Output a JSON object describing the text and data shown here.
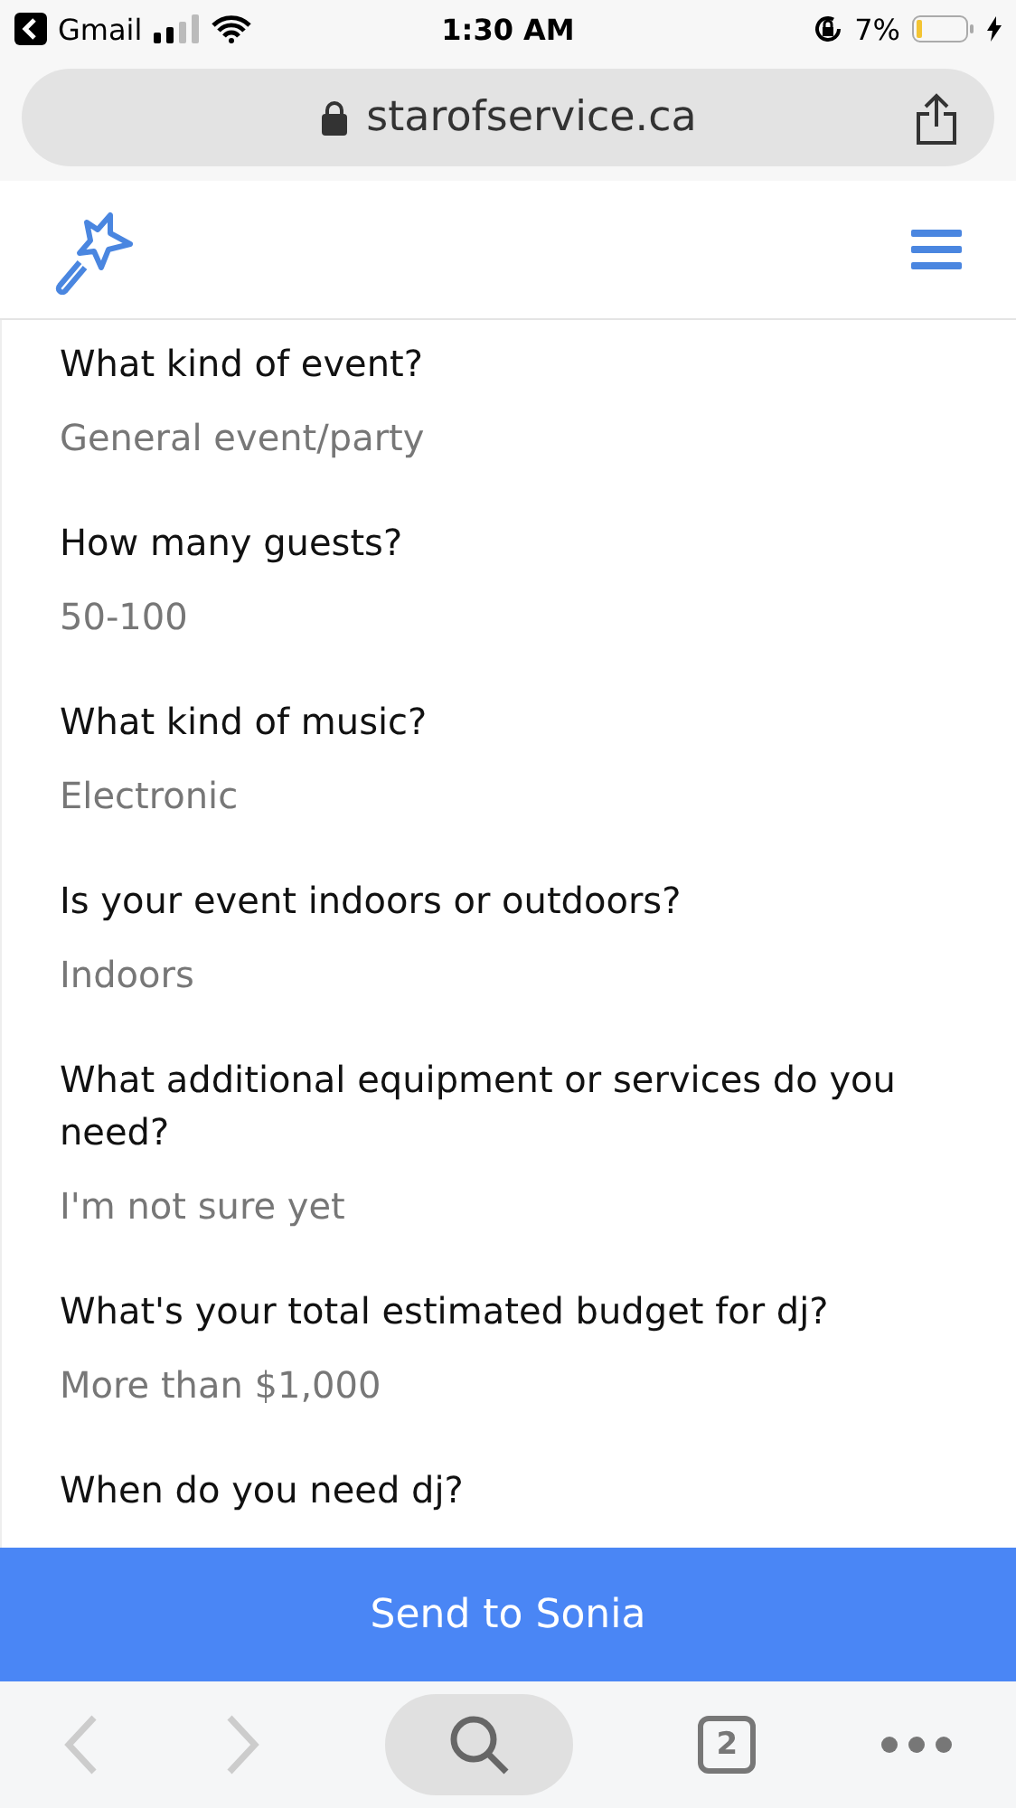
{
  "status_bar": {
    "back_app": "Gmail",
    "time": "1:30 AM",
    "battery": "7%"
  },
  "address_bar": {
    "url": "starofservice.ca"
  },
  "questions": [
    {
      "question": "What kind of event?",
      "answer": "General event/party"
    },
    {
      "question": "How many guests?",
      "answer": "50-100"
    },
    {
      "question": "What kind of music?",
      "answer": "Electronic"
    },
    {
      "question": "Is your event indoors or outdoors?",
      "answer": "Indoors"
    },
    {
      "question": "What additional equipment or services do you need?",
      "answer": "I'm not sure yet"
    },
    {
      "question": "What's your total estimated budget for dj?",
      "answer": "More than $1,000"
    },
    {
      "question": "When do you need dj?"
    }
  ],
  "send_button": {
    "label": "Send to Sonia"
  },
  "toolbar": {
    "back_disabled": true,
    "forward_disabled": true,
    "tab_count": "2"
  }
}
